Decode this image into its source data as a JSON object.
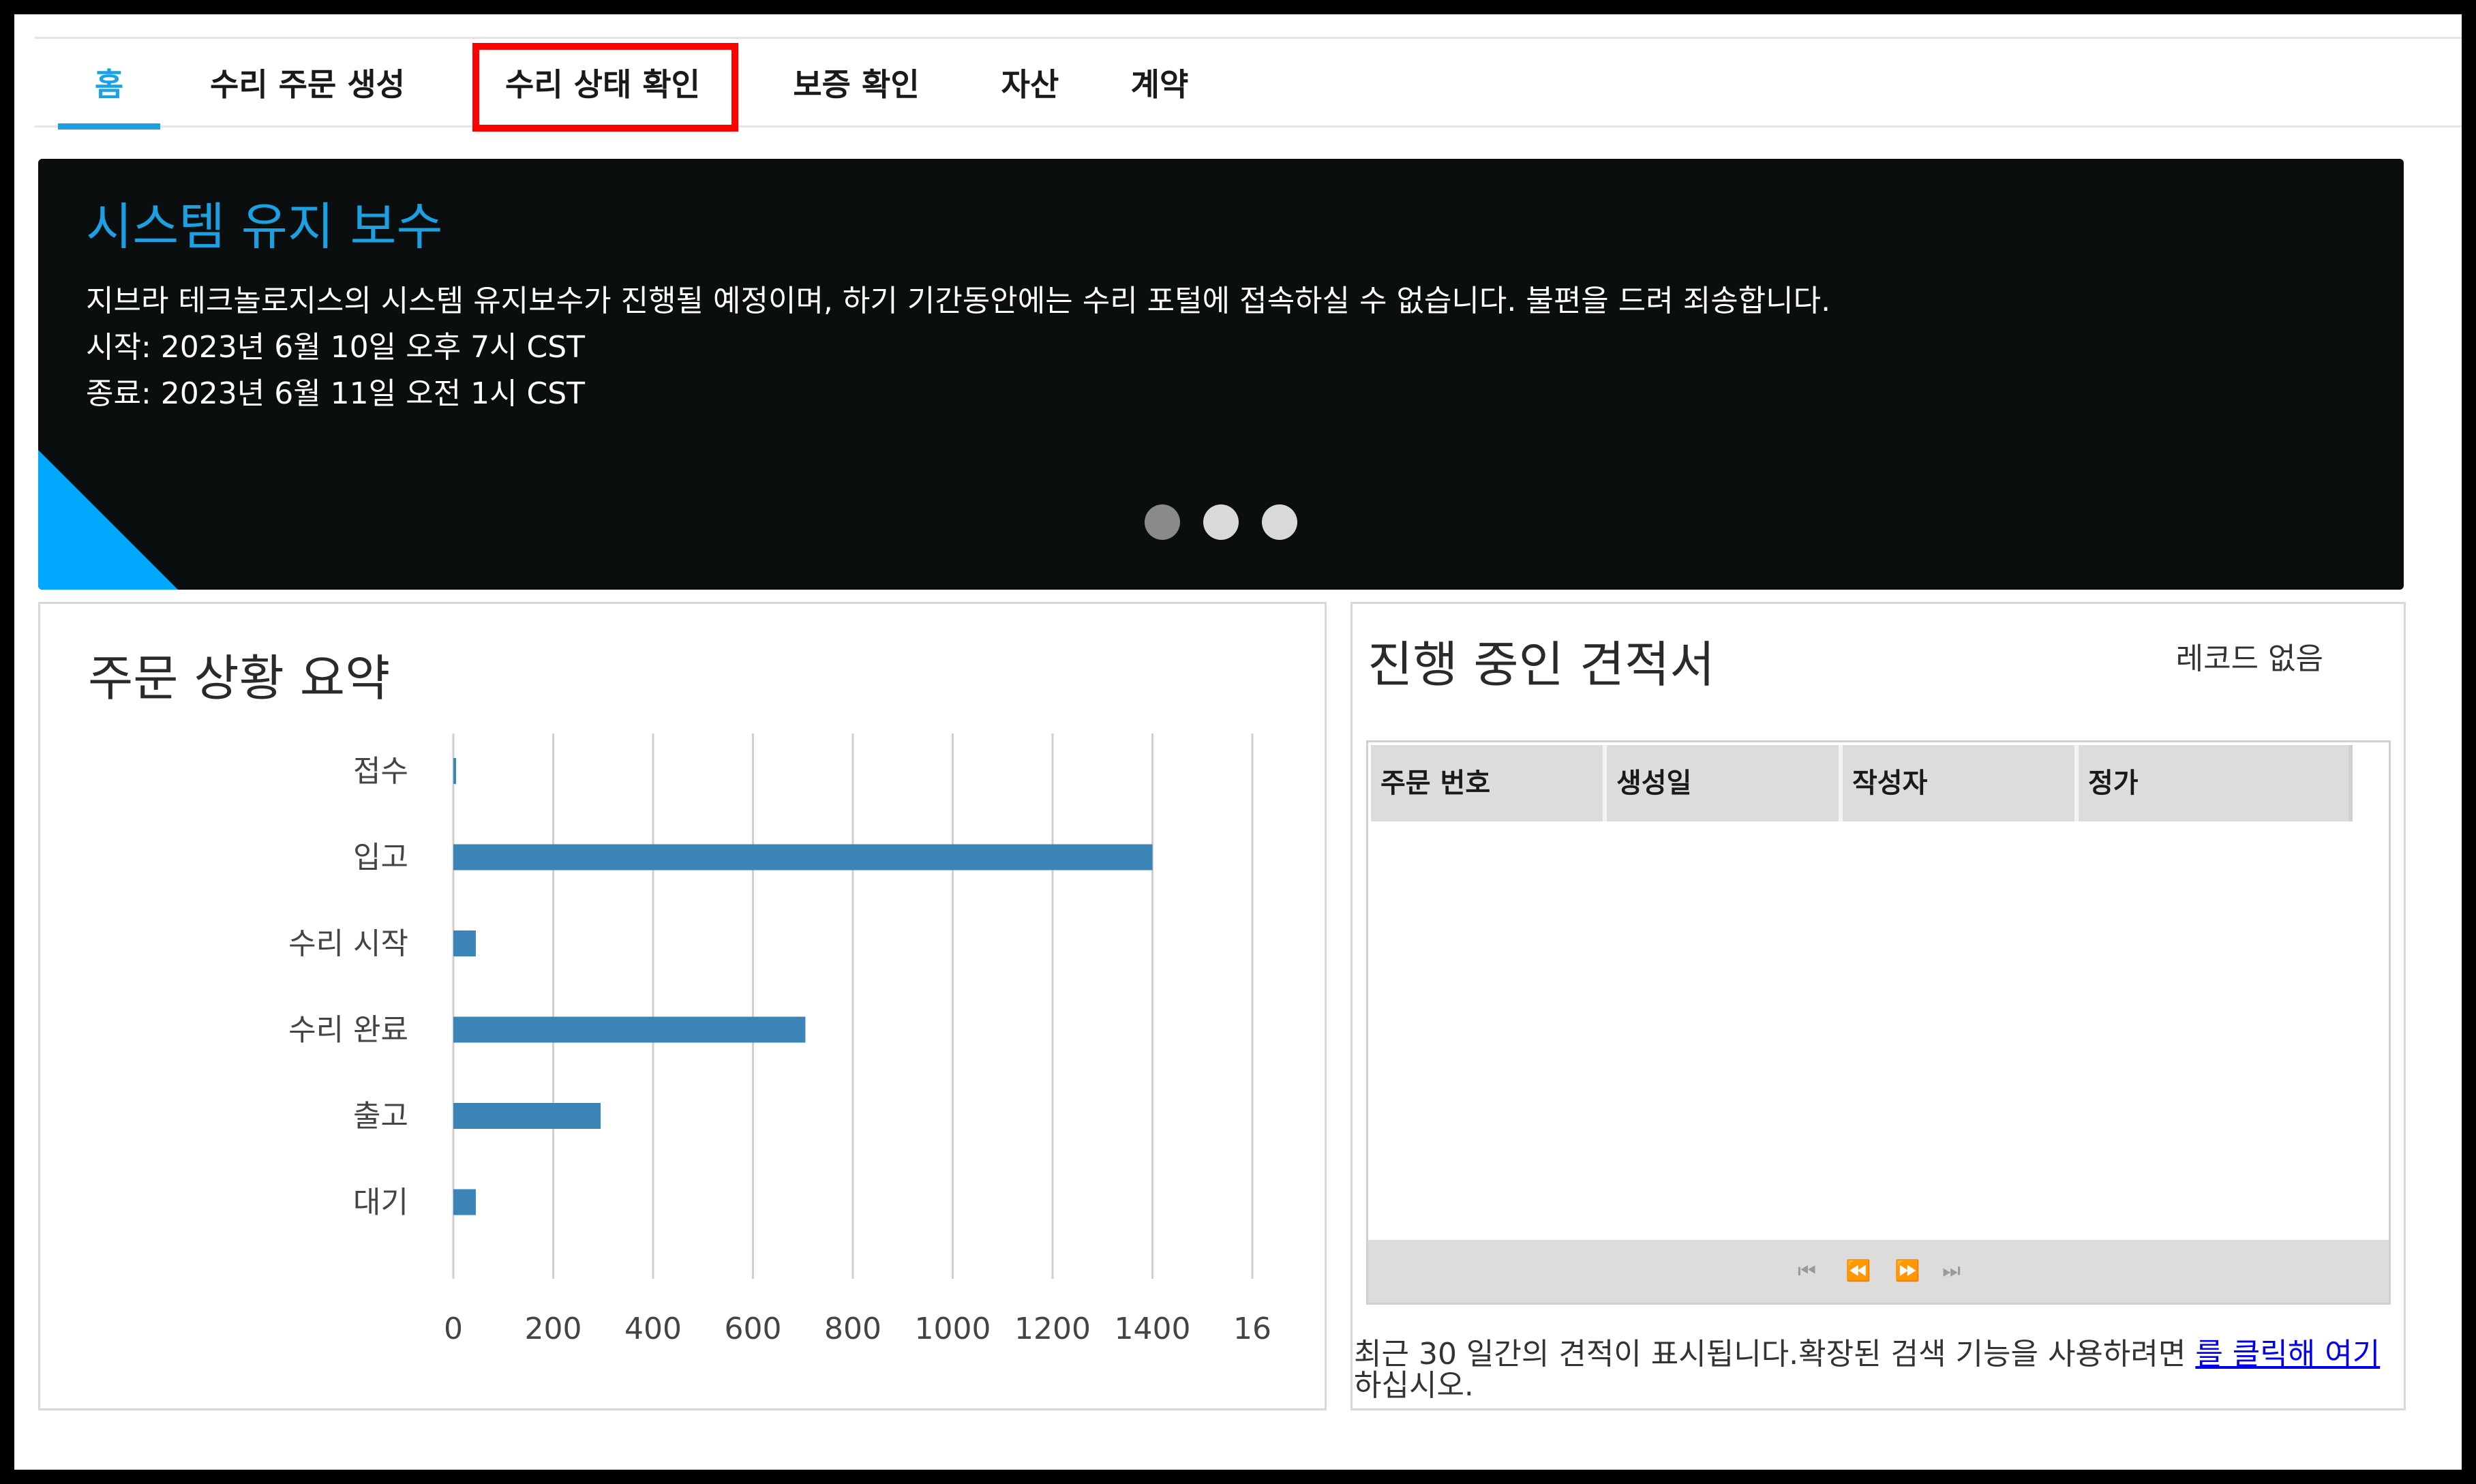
{
  "tabs": [
    {
      "label": "홈",
      "active": true
    },
    {
      "label": "수리 주문 생성",
      "active": false
    },
    {
      "label": "수리 상태 확인",
      "active": false,
      "highlighted": true
    },
    {
      "label": "보증 확인",
      "active": false
    },
    {
      "label": "자산",
      "active": false
    },
    {
      "label": "계약",
      "active": false
    }
  ],
  "banner": {
    "title": "시스템 유지 보수",
    "message": "지브라 테크놀로지스의 시스템 유지보수가 진행될 예정이며, 하기 기간동안에는 수리 포털에 접속하실 수 없습니다. 불편을 드려 죄송합니다.",
    "start": "시작: 2023년 6월 10일 오후 7시 CST",
    "end": "종료: 2023년 6월 11일 오전 1시 CST",
    "slides": 3,
    "active_slide": 0
  },
  "summary": {
    "title": "주문 상황 요약"
  },
  "chart_data": {
    "type": "bar",
    "orientation": "horizontal",
    "title": "주문 상황 요약",
    "categories": [
      "접수",
      "입고",
      "수리 시작",
      "수리 완료",
      "출고",
      "대기"
    ],
    "values": [
      5,
      1400,
      45,
      705,
      295,
      45
    ],
    "xlim": [
      0,
      1600
    ],
    "xticks": [
      0,
      200,
      400,
      600,
      800,
      1000,
      1200,
      1400,
      1600
    ],
    "xtick_labels": [
      "0",
      "200",
      "400",
      "600",
      "800",
      "1000",
      "1200",
      "1400",
      "16"
    ],
    "grid": true,
    "bar_color": "#3b84b7"
  },
  "quotes": {
    "title": "진행 중인 견적서",
    "no_records": "레코드 없음",
    "columns": [
      "주문 번호",
      "생성일",
      "작성자",
      "정가"
    ],
    "rows": [],
    "pager": {
      "first": "⏮",
      "prev": "⏪",
      "next": "⏩",
      "last": "⏭"
    },
    "note_text": "최근 30 일간의 견적이 표시됩니다.확장된 검색 기능을 사용하려면 ",
    "note_link": "를 클릭해 여기",
    "note_suffix": " 하십시오."
  },
  "colors": {
    "accent": "#1ba1e2",
    "banner_bg": "#0b0e0e",
    "highlight_box": "#ff0000",
    "corner": "#00a8ff"
  }
}
